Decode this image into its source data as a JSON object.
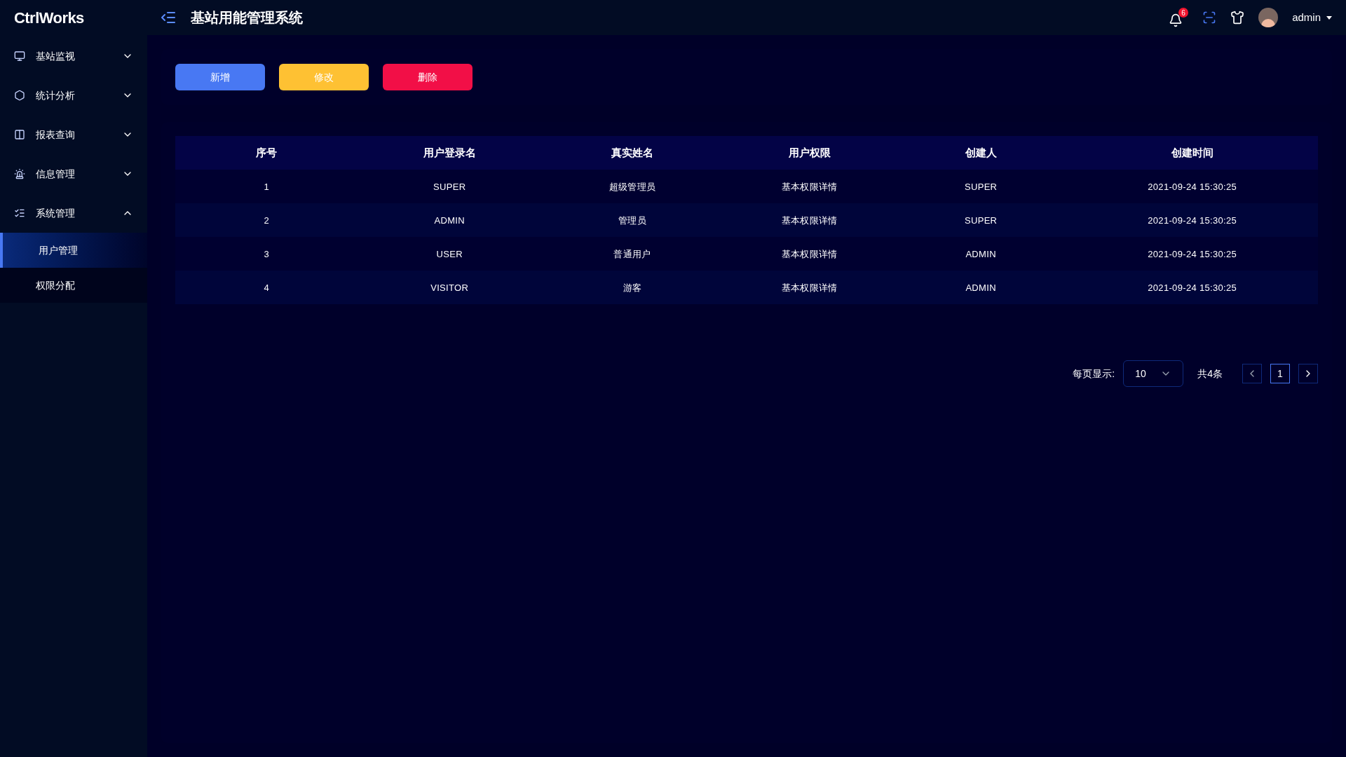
{
  "logo": "CtrlWorks",
  "header": {
    "title": "基站用能管理系统",
    "notification_count": "6",
    "user": "admin"
  },
  "sidebar": {
    "items": [
      {
        "label": "基站监视",
        "expanded": false
      },
      {
        "label": "统计分析",
        "expanded": false
      },
      {
        "label": "报表查询",
        "expanded": false
      },
      {
        "label": "信息管理",
        "expanded": false
      },
      {
        "label": "系统管理",
        "expanded": true,
        "children": [
          {
            "label": "用户管理",
            "selected": true
          },
          {
            "label": "权限分配",
            "selected": false
          }
        ]
      }
    ]
  },
  "toolbar": {
    "buttons": [
      {
        "label": "新增",
        "kind": "add"
      },
      {
        "label": "修改",
        "kind": "edit"
      },
      {
        "label": "删除",
        "kind": "delete"
      }
    ]
  },
  "table": {
    "columns": [
      "序号",
      "用户登录名",
      "真实姓名",
      "用户权限",
      "创建人",
      "创建时间"
    ],
    "rows": [
      [
        "1",
        "SUPER",
        "超级管理员",
        "基本权限详情",
        "SUPER",
        "2021-09-24 15:30:25"
      ],
      [
        "2",
        "ADMIN",
        "管理员",
        "基本权限详情",
        "SUPER",
        "2021-09-24 15:30:25"
      ],
      [
        "3",
        "USER",
        "普通用户",
        "基本权限详情",
        "ADMIN",
        "2021-09-24 15:30:25"
      ],
      [
        "4",
        "VISITOR",
        "游客",
        "基本权限详情",
        "ADMIN",
        "2021-09-24 15:30:25"
      ]
    ]
  },
  "pagination": {
    "page_size_label": "每页显示:",
    "page_size": "10",
    "total": "共4条",
    "pages": [
      {
        "label": "1",
        "selected": true
      }
    ]
  }
}
